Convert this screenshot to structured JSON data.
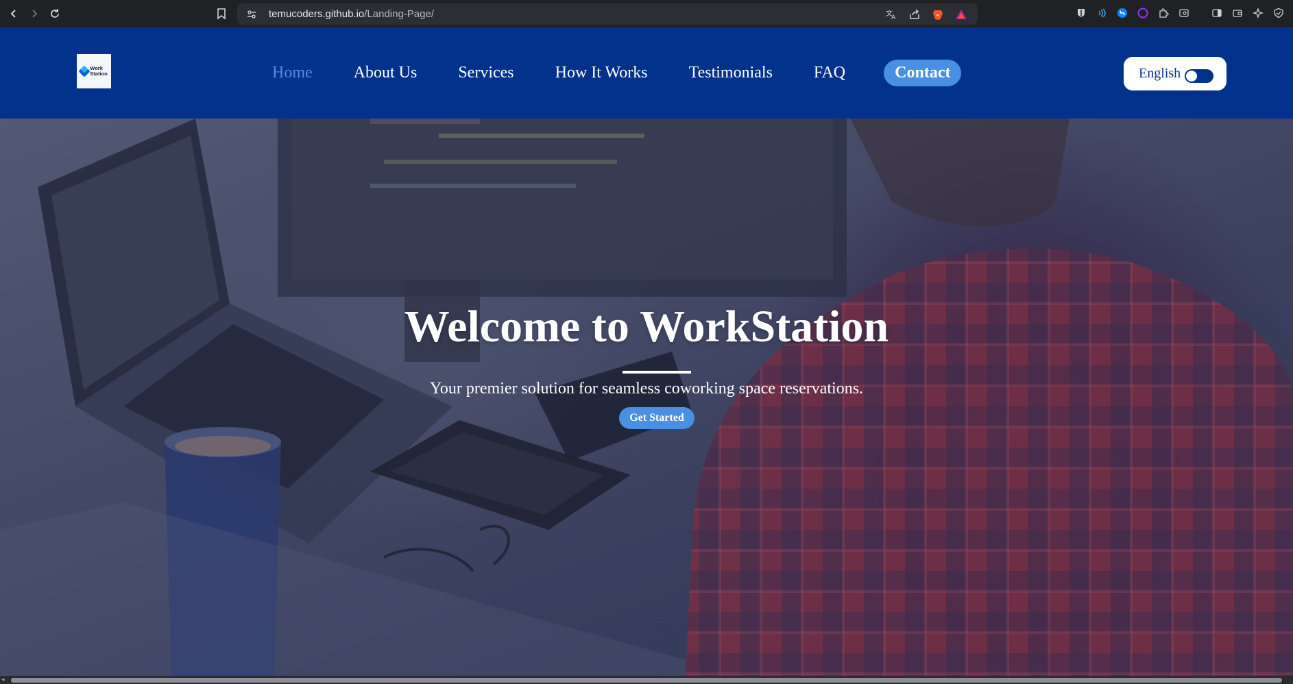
{
  "browser": {
    "url_host": "temucoders.github.io",
    "url_path": "/Landing-Page/",
    "icons": {
      "back": "back-arrow-icon",
      "forward": "forward-arrow-icon",
      "reload": "reload-icon",
      "bookmark": "bookmark-icon",
      "site_info": "site-settings-icon",
      "translate": "translate-icon",
      "share": "share-icon",
      "brave_shields": "brave-lion-icon",
      "rewards": "brave-rewards-icon"
    }
  },
  "header": {
    "logo_text_line1": "Work",
    "logo_text_line2": "Station",
    "nav": [
      {
        "label": "Home",
        "active": true
      },
      {
        "label": "About Us"
      },
      {
        "label": "Services"
      },
      {
        "label": "How It Works"
      },
      {
        "label": "Testimonials"
      },
      {
        "label": "FAQ"
      }
    ],
    "contact_label": "Contact",
    "language_label": "English"
  },
  "hero": {
    "title": "Welcome to WorkStation",
    "subtitle": "Your premier solution for seamless coworking space reservations.",
    "cta_label": "Get Started"
  },
  "colors": {
    "header_bg": "#02328c",
    "accent": "#4a90e2",
    "text_light": "#ffffff"
  }
}
